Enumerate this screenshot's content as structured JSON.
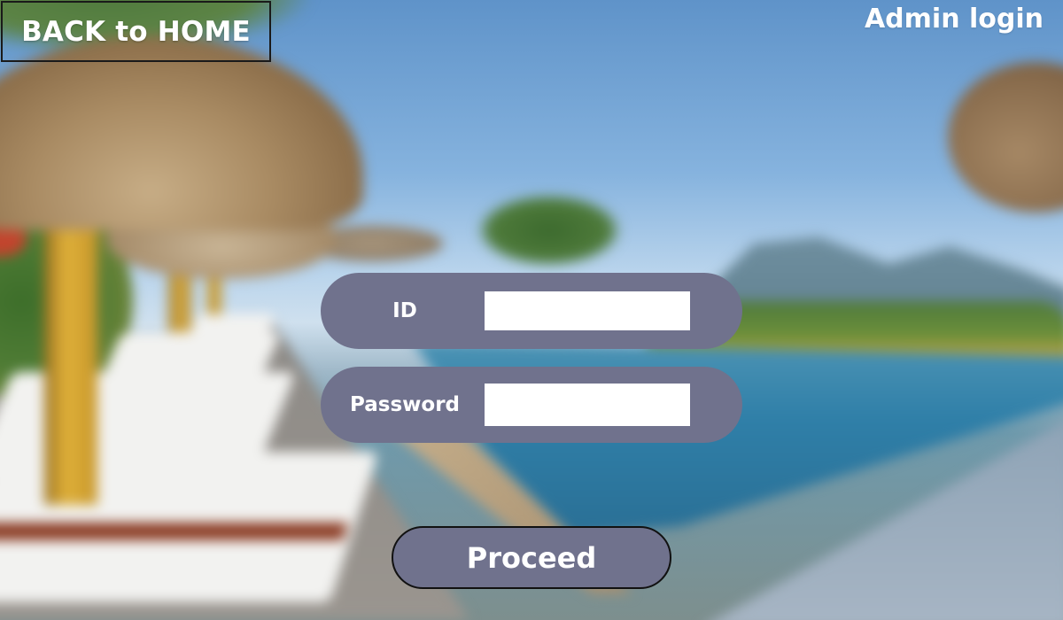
{
  "header": {
    "back_label": "BACK to HOME",
    "title": "Admin login"
  },
  "form": {
    "id_label": "ID",
    "id_value": "",
    "password_label": "Password",
    "password_value": "",
    "submit_label": "Proceed"
  },
  "colors": {
    "panel": "#70728d",
    "text": "#ffffff",
    "border": "#111111"
  }
}
